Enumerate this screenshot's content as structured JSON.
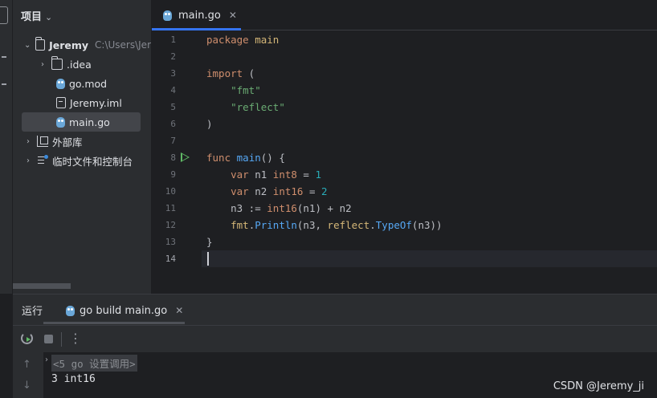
{
  "project_panel": {
    "title": "项目",
    "tree": [
      {
        "label": "Jeremy",
        "path": "C:\\Users\\Jer",
        "expanded": true
      },
      {
        "label": ".idea",
        "expanded": false
      },
      {
        "label": "go.mod"
      },
      {
        "label": "Jeremy.iml"
      },
      {
        "label": "main.go",
        "selected": true
      },
      {
        "label": "外部库",
        "expanded": false
      },
      {
        "label": "临时文件和控制台",
        "expanded": false
      }
    ]
  },
  "editor": {
    "tab_label": "main.go",
    "line_numbers": [
      "1",
      "2",
      "3",
      "4",
      "5",
      "6",
      "7",
      "8",
      "9",
      "10",
      "11",
      "12",
      "13",
      "14"
    ],
    "current_line": 14
  },
  "run_panel": {
    "title": "运行",
    "tab_label": "go build main.go",
    "console_command": "<5 go 设置调用>",
    "console_output": "3 int16"
  },
  "watermark": "CSDN @Jeremy_ji",
  "colors": {
    "accent": "#3574f0",
    "run_green": "#5fb865",
    "keyword": "#cf8e6d",
    "string": "#6aab73",
    "number": "#2aacb8",
    "function": "#56a8f5"
  },
  "icons": [
    "gopher-file-icon",
    "folder-icon",
    "file-icon",
    "library-icon",
    "scratch-icon",
    "run-icon",
    "rerun-icon",
    "stop-icon",
    "more-icon",
    "close-icon",
    "chevron-down-icon"
  ]
}
